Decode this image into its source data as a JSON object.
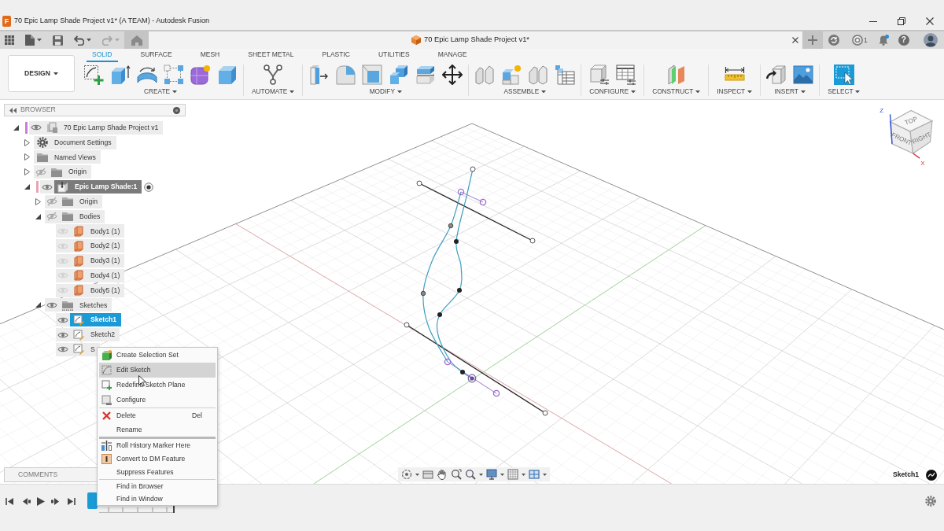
{
  "window": {
    "logo": "F",
    "title": "70 Epic Lamp Shade Project v1* (A TEAM) - Autodesk Fusion"
  },
  "history_buttons": [
    {
      "kind": "undo",
      "disabled": false
    },
    {
      "kind": "redo",
      "disabled": true
    }
  ],
  "document_tab": {
    "title": "70 Epic Lamp Shade Project v1*"
  },
  "job_status": {
    "count": "1"
  },
  "notifications": {
    "unread": true
  },
  "help": {
    "label": "?"
  },
  "workspace": {
    "label": "DESIGN"
  },
  "toolbar_tabs": [
    {
      "label": "SOLID",
      "selected": true
    },
    {
      "label": "SURFACE",
      "selected": false
    },
    {
      "label": "MESH",
      "selected": false
    },
    {
      "label": "SHEET METAL",
      "selected": false
    },
    {
      "label": "PLASTIC",
      "selected": false
    },
    {
      "label": "UTILITIES",
      "selected": false
    },
    {
      "label": "MANAGE",
      "selected": false
    }
  ],
  "tool_groups": [
    {
      "label": "CREATE"
    },
    {
      "label": "AUTOMATE"
    },
    {
      "label": "MODIFY"
    },
    {
      "label": "ASSEMBLE"
    },
    {
      "label": "CONFIGURE"
    },
    {
      "label": "CONSTRUCT"
    },
    {
      "label": "INSPECT"
    },
    {
      "label": "INSERT"
    },
    {
      "label": "SELECT"
    }
  ],
  "browser": {
    "title": "BROWSER",
    "tree": [
      {
        "label": "70 Epic Lamp Shade Project v1",
        "kind": "document",
        "color": "#c77dd9",
        "expanded": true,
        "visible": true,
        "selected": false,
        "children": [
          {
            "label": "Document Settings",
            "kind": "settings",
            "expanded": false,
            "selected": false
          },
          {
            "label": "Named Views",
            "kind": "folder",
            "expanded": false,
            "selected": false
          },
          {
            "label": "Origin",
            "kind": "folder",
            "expanded": false,
            "visible": false,
            "selected": false
          },
          {
            "label": "Epic Lamp Shade:1",
            "kind": "component",
            "color": "#eaa3b6",
            "expanded": true,
            "visible": true,
            "active": true,
            "selected": false,
            "children": [
              {
                "label": "Origin",
                "kind": "folder",
                "expanded": false,
                "visible": false,
                "selected": false
              },
              {
                "label": "Bodies",
                "kind": "folder",
                "expanded": true,
                "visible": false,
                "selected": false,
                "children": [
                  {
                    "label": "Body1 (1)",
                    "kind": "body",
                    "visible": true,
                    "selected": false
                  },
                  {
                    "label": "Body2 (1)",
                    "kind": "body",
                    "visible": true,
                    "selected": false
                  },
                  {
                    "label": "Body3 (1)",
                    "kind": "body",
                    "visible": true,
                    "selected": false
                  },
                  {
                    "label": "Body4 (1)",
                    "kind": "body",
                    "visible": true,
                    "selected": false
                  },
                  {
                    "label": "Body5 (1)",
                    "kind": "body",
                    "visible": true,
                    "selected": false
                  }
                ]
              },
              {
                "label": "Sketches",
                "kind": "sketch_folder",
                "expanded": true,
                "visible": true,
                "selected": false,
                "children": [
                  {
                    "label": "Sketch1",
                    "kind": "sketch",
                    "visible": true,
                    "selected": true
                  },
                  {
                    "label": "Sketch2",
                    "kind": "sketch",
                    "visible": true,
                    "selected": false
                  },
                  {
                    "label": "S",
                    "kind": "sketch",
                    "visible": true,
                    "selected": false
                  }
                ]
              }
            ]
          }
        ]
      }
    ]
  },
  "context_menu": {
    "groups": [
      [
        {
          "label": "Create Selection Set",
          "selected": false
        },
        {
          "label": "Edit Sketch",
          "selected": true
        },
        {
          "label": "Redefine Sketch Plane",
          "selected": false
        },
        {
          "label": "Configure",
          "selected": false
        }
      ],
      [
        {
          "label": "Delete",
          "shortcut": "Del",
          "selected": false
        },
        {
          "label": "Rename",
          "selected": false
        }
      ],
      [
        {
          "label": "Roll History Marker Here",
          "selected": false
        },
        {
          "label": "Convert to DM Feature",
          "selected": false
        },
        {
          "label": "Suppress Features",
          "selected": false
        }
      ],
      [
        {
          "label": "Find in Browser",
          "selected": false
        },
        {
          "label": "Find in Window",
          "selected": false
        }
      ]
    ]
  },
  "comments": {
    "title": "COMMENTS"
  },
  "view_cube": {
    "faces": [
      "TOP",
      "FRONT",
      "RIGHT"
    ],
    "axes": [
      "Z",
      "X"
    ]
  },
  "status": {
    "active_sketch": "Sketch1"
  }
}
